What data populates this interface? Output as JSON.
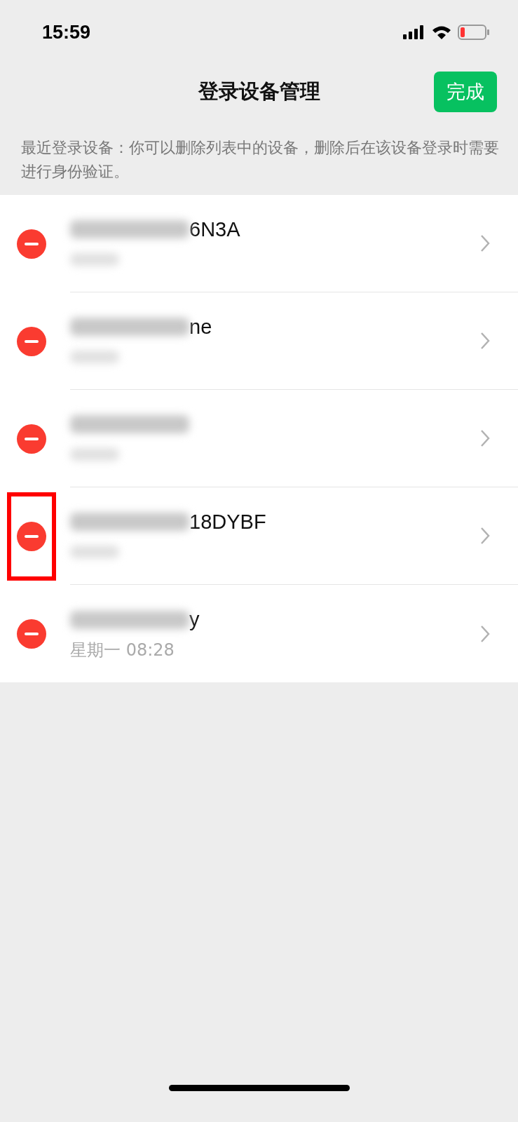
{
  "status_bar": {
    "time": "15:59"
  },
  "nav": {
    "title": "登录设备管理",
    "done_button": "完成"
  },
  "description": "最近登录设备：你可以删除列表中的设备，删除后在该设备登录时需要进行身份验证。",
  "devices": [
    {
      "name": "6N3A",
      "highlighted": false
    },
    {
      "name": "ne",
      "highlighted": false
    },
    {
      "highlighted": false
    },
    {
      "name": "18DYBF",
      "highlighted": true
    },
    {
      "name": "y",
      "time": "星期一 08:28",
      "highlighted": false
    }
  ]
}
